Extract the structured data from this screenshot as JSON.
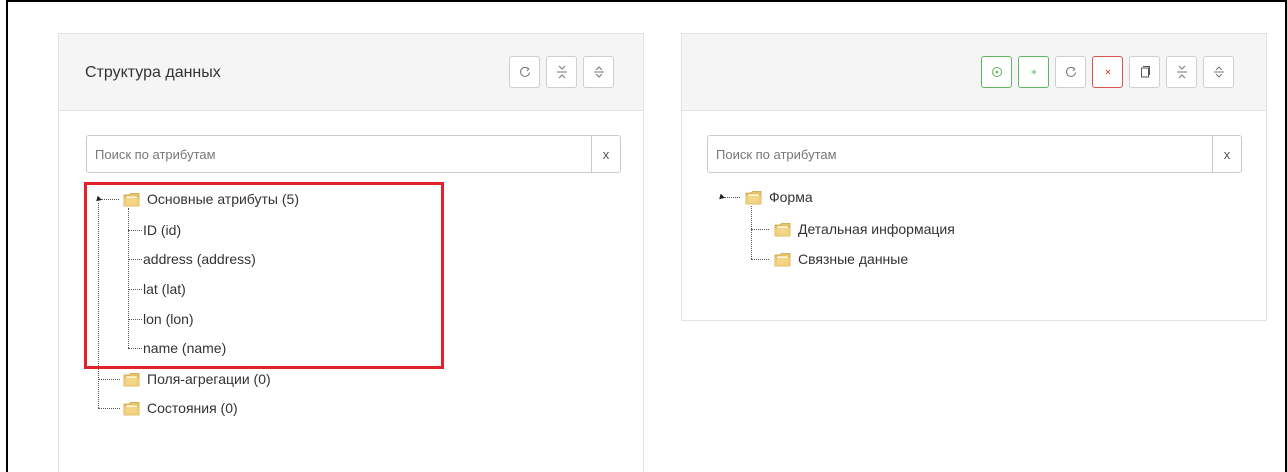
{
  "left_panel": {
    "title": "Структура данных",
    "toolbar": [
      {
        "icon": "refresh-icon"
      },
      {
        "icon": "collapse-icon"
      },
      {
        "icon": "expand-icon"
      }
    ],
    "search": {
      "placeholder": "Поиск по атрибутам",
      "value": "",
      "clear_label": "x"
    },
    "tree": {
      "root_label": "Основные атрибуты (5)",
      "children": [
        "ID (id)",
        "address (address)",
        "lat (lat)",
        "lon (lon)",
        "name (name)"
      ],
      "siblings": [
        "Поля-агрегации (0)",
        "Состояния (0)"
      ]
    },
    "highlight_color": "#e0222a"
  },
  "right_panel": {
    "toolbar": [
      {
        "icon": "target-icon",
        "color": "#5cb85c"
      },
      {
        "icon": "plus-icon",
        "color": "#5cb85c"
      },
      {
        "icon": "refresh-icon"
      },
      {
        "icon": "close-icon",
        "color": "#d9534f"
      },
      {
        "icon": "copy-icon"
      },
      {
        "icon": "collapse-icon"
      },
      {
        "icon": "expand-icon"
      }
    ],
    "search": {
      "placeholder": "Поиск по атрибутам",
      "value": "",
      "clear_label": "x"
    },
    "tree": {
      "root_label": "Форма",
      "children": [
        "Детальная информация",
        "Связные данные"
      ]
    }
  },
  "colors": {
    "folder": "#e8c56a",
    "folder_dark": "#c9a23f",
    "green": "#5cb85c",
    "red": "#d9534f"
  }
}
